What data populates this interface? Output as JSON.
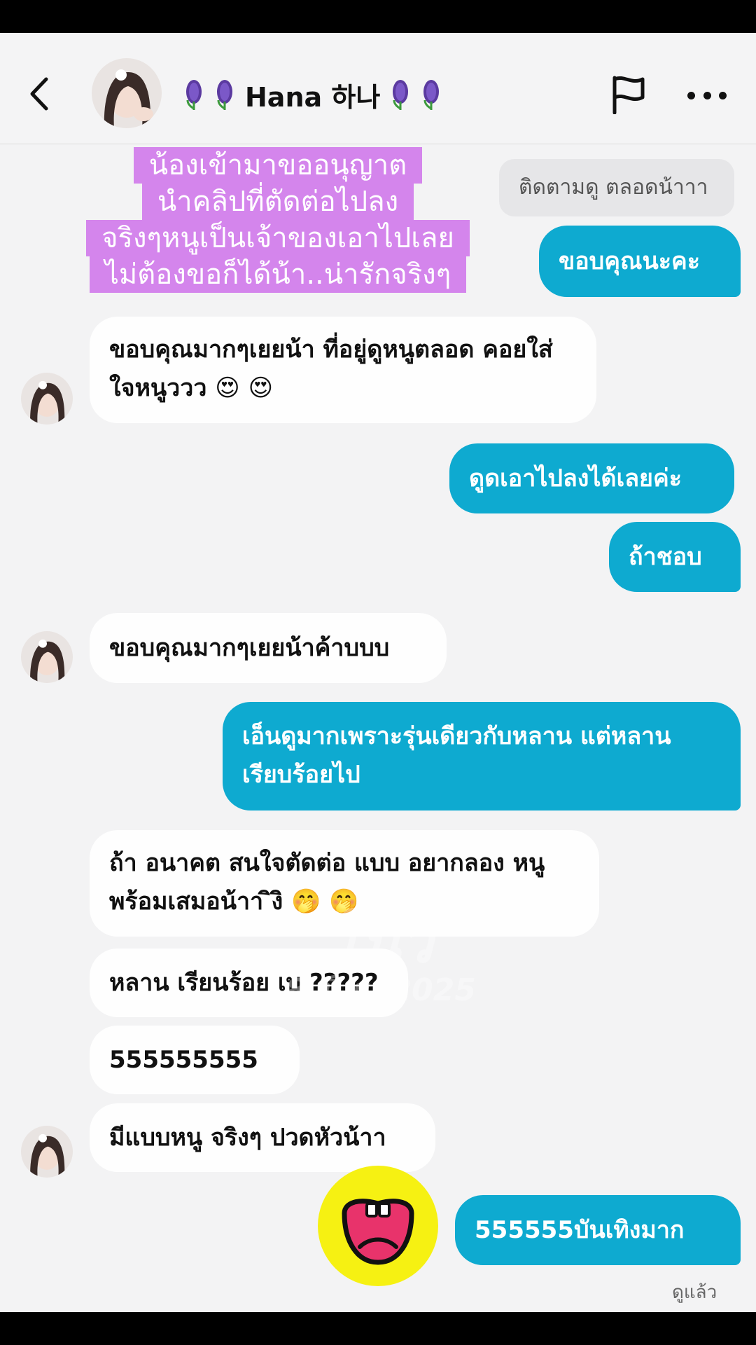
{
  "header": {
    "contact_name": "Hana 하나",
    "flower_icon": "hyacinth-emoji",
    "back_icon": "chevron-left-icon",
    "flag_icon": "flag-icon",
    "more_icon": "more-dots-icon"
  },
  "overlay_caption": {
    "lines": [
      "น้องเข้ามาขออนุญาต",
      "นำคลิปที่ตัดต่อไปลง",
      "จริงๆหนูเป็นเจ้าของเอาไปเลย",
      "ไม่ต้องขอก็ได้น้า..น่ารักจริงๆ"
    ]
  },
  "messages": [
    {
      "from": "contact",
      "type": "reply_preview",
      "text": "ติดตามดู ตลอดน้าาา"
    },
    {
      "from": "me",
      "text": "ขอบคุณนะคะ"
    },
    {
      "from": "contact",
      "text": "ขอบคุณมากๆเยยน้า ที่อยู่ดูหนูตลอด คอยใส่ใจหนูววว 😍 😍"
    },
    {
      "from": "me",
      "text": "ดูดเอาไปลงได้เลยค่ะ"
    },
    {
      "from": "me",
      "text": "ถ้าชอบ"
    },
    {
      "from": "contact",
      "text": "ขอบคุณมากๆเยยน้าค้าบบบ"
    },
    {
      "from": "me",
      "text": "เอ็นดูมากเพราะรุ่นเดียวกับหลาน แต่หลานเรียบร้อยไป"
    },
    {
      "from": "contact",
      "text": "ถ้า อนาคต สนใจตัดต่อ แบบ อยากลอง หนูพร้อมเสมอน้าา  ิงิ 🤭 🤭"
    },
    {
      "from": "contact",
      "text": "หลาน เรียนร้อย เบ ?????"
    },
    {
      "from": "contact",
      "text": "555555555"
    },
    {
      "from": "contact",
      "text": "มีแบบหนู จริงๆ ปวดหัวน้าา"
    },
    {
      "from": "me",
      "text": "555555บันเทิงมาก"
    }
  ],
  "watermark": {
    "line1": "โนวี่",
    "line2": "8 มิ.ย. 2025"
  },
  "status": {
    "seen": "ดูแล้ว"
  },
  "sticker": "laughing-yellow-face-sticker"
}
